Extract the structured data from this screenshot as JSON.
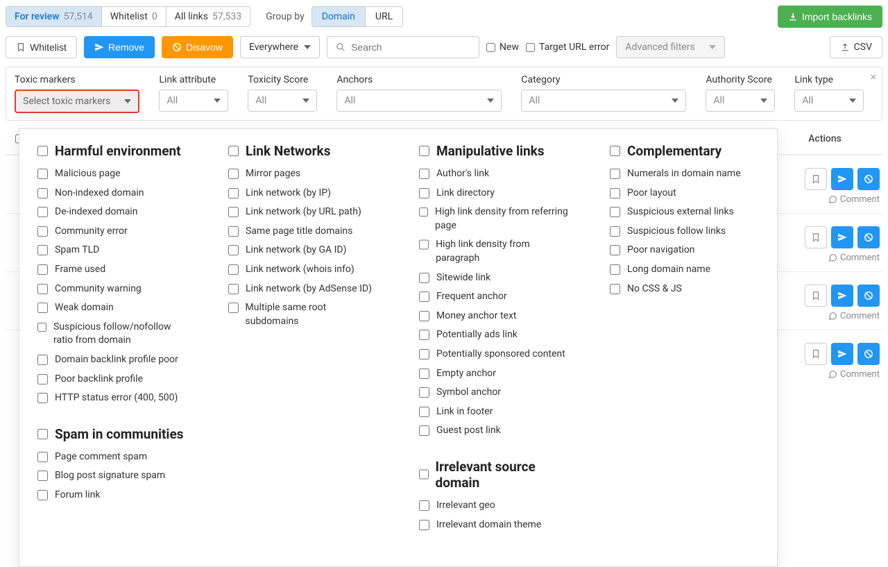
{
  "top_tabs": [
    {
      "label": "For review",
      "count": "57,514",
      "active": true
    },
    {
      "label": "Whitelist",
      "count": "0",
      "active": false
    },
    {
      "label": "All links",
      "count": "57,533",
      "active": false
    }
  ],
  "group_by": {
    "label": "Group by",
    "options": [
      {
        "label": "Domain",
        "active": true
      },
      {
        "label": "URL",
        "active": false
      }
    ]
  },
  "import_button": "Import backlinks",
  "actions": {
    "whitelist": "Whitelist",
    "remove": "Remove",
    "disavow": "Disavow",
    "everywhere": "Everywhere",
    "search_placeholder": "Search",
    "new": "New",
    "target_url_error": "Target URL error",
    "advanced_filters": "Advanced filters",
    "csv": "CSV"
  },
  "filters": {
    "toxic_markers": {
      "label": "Toxic markers",
      "value": "Select toxic markers"
    },
    "link_attribute": {
      "label": "Link attribute",
      "value": "All"
    },
    "toxicity_score": {
      "label": "Toxicity Score",
      "value": "All"
    },
    "anchors": {
      "label": "Anchors",
      "value": "All"
    },
    "category": {
      "label": "Category",
      "value": "All"
    },
    "authority_score": {
      "label": "Authority Score",
      "value": "All"
    },
    "link_type": {
      "label": "Link type",
      "value": "All"
    }
  },
  "dropdown": {
    "sections": [
      {
        "title": "Harmful environment",
        "col": 0,
        "items": [
          "Malicious page",
          "Non-indexed domain",
          "De-indexed domain",
          "Community error",
          "Spam TLD",
          "Frame used",
          "Community warning",
          "Weak domain",
          "Suspicious follow/nofollow ratio from domain",
          "Domain backlink profile poor",
          "Poor backlink profile",
          "HTTP status error (400, 500)"
        ]
      },
      {
        "title": "Spam in communities",
        "col": 0,
        "items": [
          "Page comment spam",
          "Blog post signature spam",
          "Forum link"
        ]
      },
      {
        "title": "Link Networks",
        "col": 1,
        "items": [
          "Mirror pages",
          "Link network (by IP)",
          "Link network (by URL path)",
          "Same page title domains",
          "Link network (by GA ID)",
          "Link network (whois info)",
          "Link network (by AdSense ID)",
          "Multiple same root subdomains"
        ]
      },
      {
        "title": "Manipulative links",
        "col": 2,
        "items": [
          "Author's link",
          "Link directory",
          "High link density from referring page",
          "High link density from paragraph",
          "Sitewide link",
          "Frequent anchor",
          "Money anchor text",
          "Potentially ads link",
          "Potentially sponsored content",
          "Empty anchor",
          "Symbol anchor",
          "Link in footer",
          "Guest post link"
        ]
      },
      {
        "title": "Irrelevant source domain",
        "col": 2,
        "items": [
          "Irrelevant geo",
          "Irrelevant domain theme"
        ]
      },
      {
        "title": "Complementary",
        "col": 3,
        "items": [
          "Numerals in domain name",
          "Poor layout",
          "Suspicious external links",
          "Suspicious follow links",
          "Poor navigation",
          "Long domain name",
          "No CSS & JS"
        ]
      }
    ]
  },
  "table": {
    "actions_header": "Actions",
    "comment": "Comment"
  }
}
